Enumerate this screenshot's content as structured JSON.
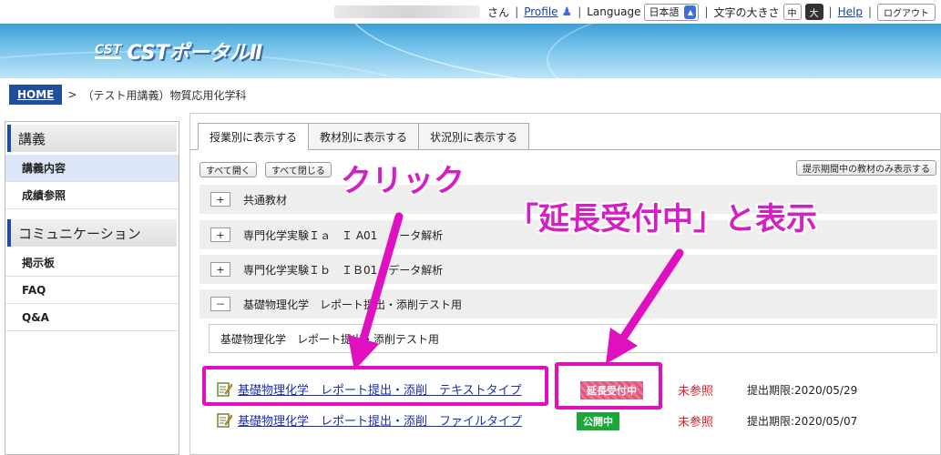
{
  "topbar": {
    "san": "さん",
    "profile": "Profile",
    "language_label": "Language",
    "language_value": "日本語",
    "textsize_label": "文字の大きさ",
    "size_medium": "中",
    "size_large": "大",
    "help": "Help",
    "logout": "ログアウト"
  },
  "banner": {
    "cst": "CST",
    "title": "CSTポータルⅡ"
  },
  "breadcrumb": {
    "home": "HOME",
    "sep": ">",
    "course": "（テスト用講義）物質応用化学科"
  },
  "sidebar": {
    "section1": "講義",
    "items1": [
      "講義内容",
      "成績参照"
    ],
    "section2": "コミュニケーション",
    "items2": [
      "掲示板",
      "FAQ",
      "Q&A"
    ]
  },
  "tabs": [
    "授業別に表示する",
    "教材別に表示する",
    "状況別に表示する"
  ],
  "buttons": {
    "expand_all": "すべて開く",
    "collapse_all": "すべて閉じる",
    "show_active_only": "提示期間中の教材のみ表示する"
  },
  "accordion": [
    {
      "symbol": "+",
      "label": "共通教材"
    },
    {
      "symbol": "+",
      "label": "専門化学実験Ｉａ　Ｉ A01　データ解析"
    },
    {
      "symbol": "+",
      "label": "専門化学実験Ｉｂ　ＩＢ01　データ解析"
    },
    {
      "symbol": "－",
      "label": "基礎物理化学　レポート提出・添削テスト用"
    }
  ],
  "subsection": "基礎物理化学　レポート提出・添削テスト用",
  "materials": [
    {
      "title": "基礎物理化学　レポート提出・添削　テキストタイプ",
      "badge": "延長受付中",
      "badge_color": "#e0577a",
      "status": "未参照",
      "deadline": "提出期限:2020/05/29"
    },
    {
      "title": "基礎物理化学　レポート提出・添削　ファイルタイプ",
      "badge": "公開中",
      "badge_color": "#1aa83a",
      "status": "未参照",
      "deadline": "提出期限:2020/05/07"
    }
  ],
  "annotations": {
    "click": "クリック",
    "label": "「延長受付中」と表示"
  },
  "colors": {
    "accent": "#1f4e9a",
    "annotation": "#e010c0",
    "link": "#1a2fb0",
    "status_red": "#e01e2a"
  }
}
